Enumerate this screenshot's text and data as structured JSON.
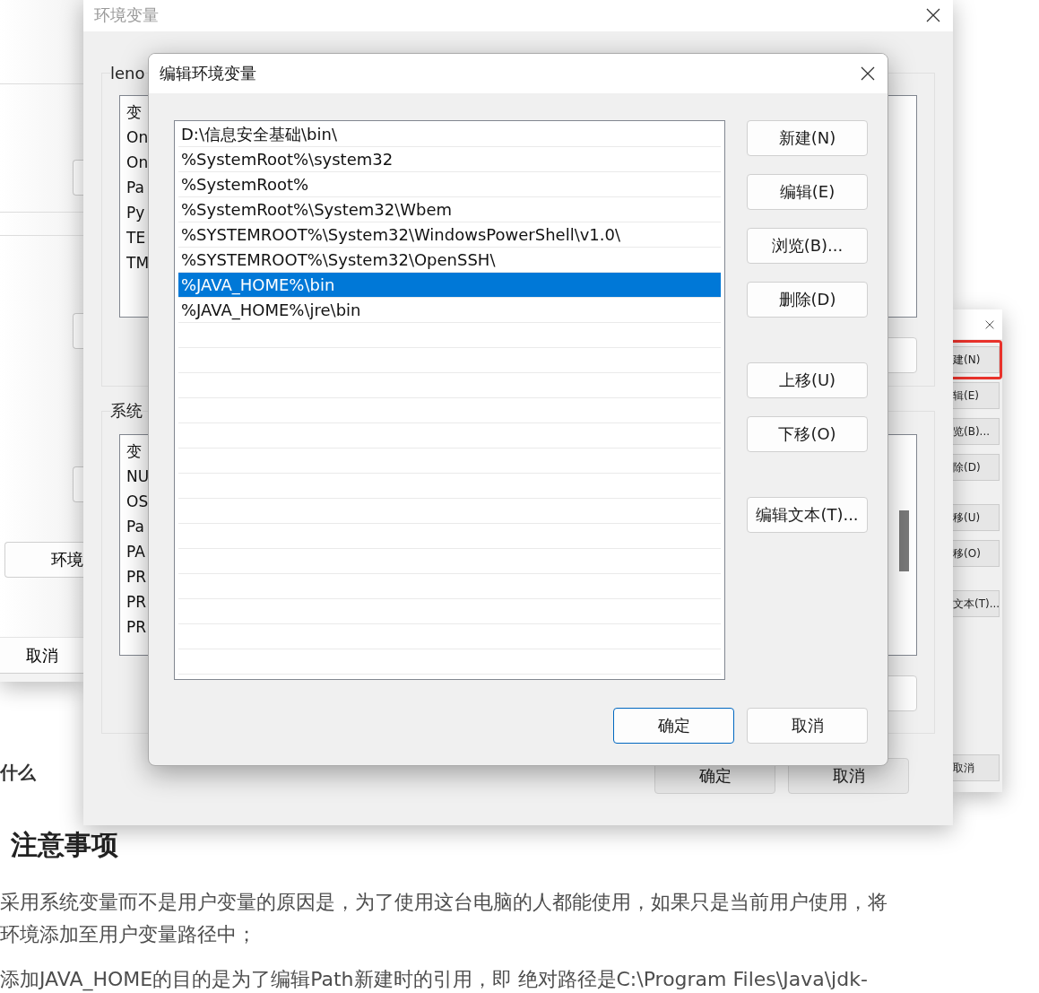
{
  "background_page": {
    "cut_heading": "什么",
    "heading": "注意事项",
    "paragraphs": [
      [
        "采用系统变量而不是用户变量的原因是，为了使用这台电脑的人都能使用，如果只是当前用户使用，将",
        "环境添加至用户变量路径中；"
      ],
      [
        "添加JAVA_HOME的目的是为了编辑Path新建时的引用，即 绝对路径是C:\\Program Files\\Java\\jdk-"
      ]
    ]
  },
  "left_window": {
    "buttons": [
      "环境",
      "取消"
    ]
  },
  "right_window": {
    "button_groups": [
      [
        {
          "label": "建(N)",
          "highlighted": true
        },
        {
          "label": "辑(E)",
          "highlighted": false
        },
        {
          "label": "览(B)...",
          "highlighted": false
        },
        {
          "label": "除(D)",
          "highlighted": false
        }
      ],
      [
        {
          "label": "移(U)",
          "highlighted": false
        },
        {
          "label": "移(O)",
          "highlighted": false
        }
      ],
      [
        {
          "label": "文本(T)...",
          "highlighted": false
        }
      ]
    ],
    "cancel": "取消"
  },
  "env_window": {
    "title": "环境变量",
    "user_group": {
      "label": "leno",
      "header": "变",
      "rows": [
        "On",
        "On",
        "Pa",
        "Py",
        "TE",
        "TM"
      ]
    },
    "system_group": {
      "label": "系统",
      "header": "变",
      "rows": [
        "NU",
        "OS",
        "Pa",
        "PA",
        "PR",
        "PR",
        "PR"
      ]
    },
    "ok": "确定",
    "cancel": "取消"
  },
  "edit_dialog": {
    "title": "编辑环境变量",
    "entries": [
      {
        "text": "D:\\信息安全基础\\bin\\",
        "selected": false
      },
      {
        "text": "%SystemRoot%\\system32",
        "selected": false
      },
      {
        "text": "%SystemRoot%",
        "selected": false
      },
      {
        "text": "%SystemRoot%\\System32\\Wbem",
        "selected": false
      },
      {
        "text": "%SYSTEMROOT%\\System32\\WindowsPowerShell\\v1.0\\",
        "selected": false
      },
      {
        "text": "%SYSTEMROOT%\\System32\\OpenSSH\\",
        "selected": false
      },
      {
        "text": "%JAVA_HOME%\\bin",
        "selected": true
      },
      {
        "text": "%JAVA_HOME%\\jre\\bin",
        "selected": false
      }
    ],
    "button_groups": [
      [
        "新建(N)",
        "编辑(E)",
        "浏览(B)...",
        "删除(D)"
      ],
      [
        "上移(U)",
        "下移(O)"
      ],
      [
        "编辑文本(T)..."
      ]
    ],
    "ok": "确定",
    "cancel": "取消"
  }
}
